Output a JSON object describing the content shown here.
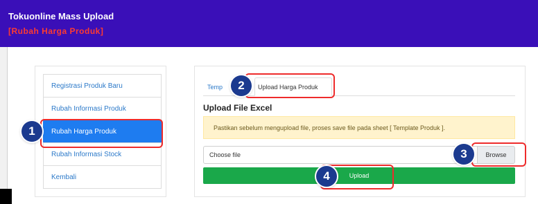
{
  "header": {
    "title": "Tokuonline Mass Upload",
    "subtitle": "[Rubah Harga Produk]"
  },
  "sidebar": {
    "items": [
      {
        "label": "Registrasi Produk Baru",
        "active": false
      },
      {
        "label": "Rubah Informasi Produk",
        "active": false
      },
      {
        "label": "Rubah Harga Produk",
        "active": true
      },
      {
        "label": "Rubah Informasi Stock",
        "active": false
      },
      {
        "label": "Kembali",
        "active": false
      }
    ]
  },
  "tabs": {
    "template_label": "Temp",
    "upload_label": "Upload Harga Produk"
  },
  "main": {
    "section_title": "Upload File Excel",
    "alert_text": "Pastikan sebelum mengupload file, proses save file pada sheet [ Template Produk ].",
    "file_input_text": "Choose file",
    "browse_label": "Browse",
    "upload_label": "Upload"
  },
  "annotations": {
    "step1": "1",
    "step2": "2",
    "step3": "3",
    "step4": "4"
  },
  "colors": {
    "header_bg": "#3a0fb8",
    "subtitle": "#ff3b30",
    "active_item": "#1e7cf0",
    "upload_button": "#1aa84a",
    "alert_bg": "#fff3cd",
    "highlight": "#ee2b2b",
    "step_badge": "#1b3a8f"
  }
}
